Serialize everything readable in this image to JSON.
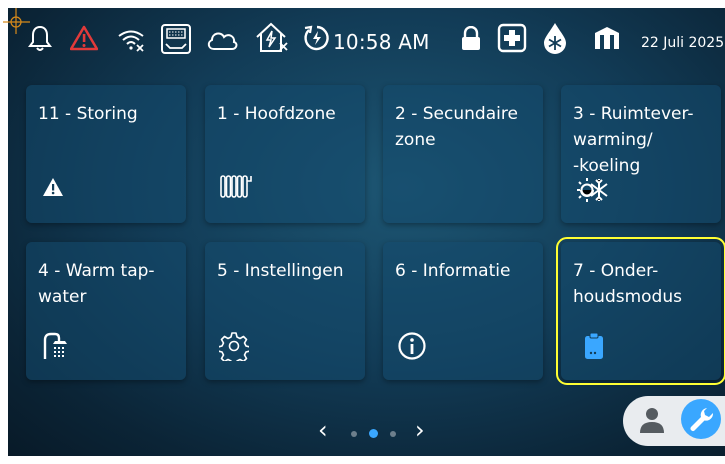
{
  "status_bar": {
    "time": "10:58 AM",
    "date": "22 Juli 2025",
    "icons": [
      "bell-icon",
      "alert-triangle-icon",
      "wifi-off-icon",
      "router-icon",
      "cloud-icon",
      "smart-home-off-icon",
      "power-cycle-icon",
      "lock-icon",
      "medical-cross-icon",
      "water-snowflake-icon",
      "building-icon"
    ]
  },
  "tiles": [
    {
      "label": "11 - Storing",
      "icon": "warning-icon"
    },
    {
      "label": "1 - Hoofdzone",
      "icon": "radiator-icon"
    },
    {
      "label": "2 - Secundaire\nzone",
      "icon": ""
    },
    {
      "label": "3 - Ruimtever-\nwarming/\n-koeling",
      "icon": "sun-snowflake-icon"
    },
    {
      "label": "4 - Warm tap-\nwater",
      "icon": "shower-icon"
    },
    {
      "label": "5 - Instellingen",
      "icon": "gear-icon"
    },
    {
      "label": "6 - Informatie",
      "icon": "info-icon"
    },
    {
      "label": "7 - Onder-\nhoudsmodus",
      "icon": "clipboard-icon"
    }
  ],
  "pagination": {
    "page_count": 3,
    "active_page": 2
  },
  "colors": {
    "accent": "#3aa7ff",
    "highlight": "#ffff33",
    "background": "#123c57"
  }
}
